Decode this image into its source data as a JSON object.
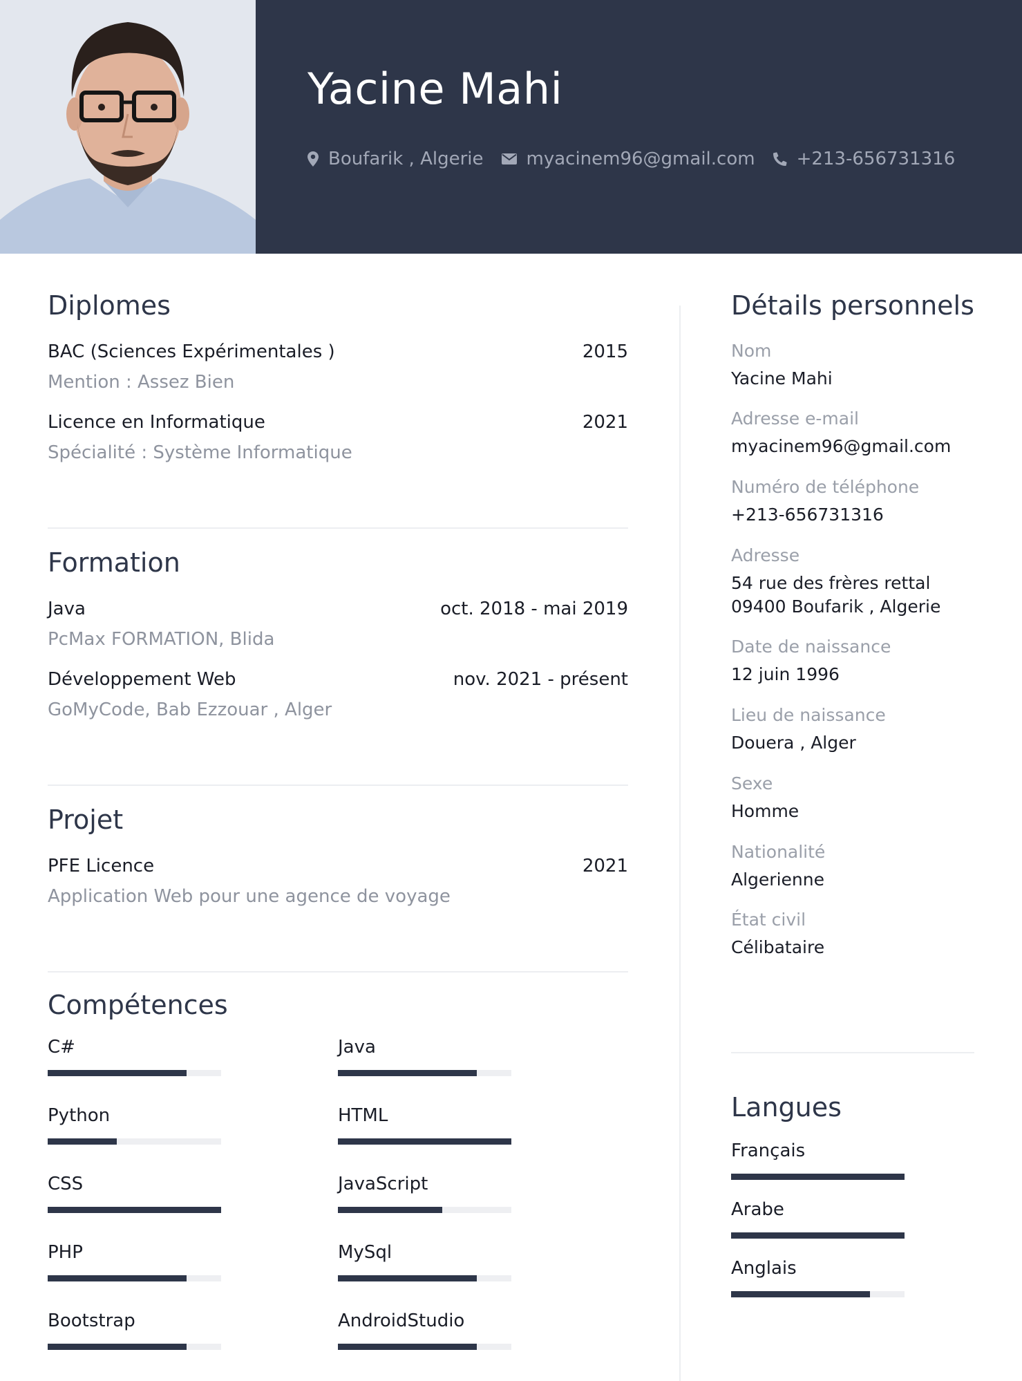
{
  "header": {
    "name": "Yacine Mahi",
    "location": "Boufarik , Algerie",
    "email": "myacinem96@gmail.com",
    "phone": "+213-656731316"
  },
  "diplomes": {
    "title": "Diplomes",
    "items": [
      {
        "title": "BAC (Sciences Expérimentales )",
        "date": "2015",
        "sub": "Mention : Assez Bien"
      },
      {
        "title": "Licence en Informatique",
        "date": "2021",
        "sub": "Spécialité : Système Informatique"
      }
    ]
  },
  "formation": {
    "title": "Formation",
    "items": [
      {
        "title": "Java",
        "date": "oct. 2018 - mai 2019",
        "sub": "PcMax FORMATION, Blida"
      },
      {
        "title": "Développement Web",
        "date": "nov. 2021 - présent",
        "sub": "GoMyCode, Bab Ezzouar , Alger"
      }
    ]
  },
  "projet": {
    "title": "Projet",
    "items": [
      {
        "title": "PFE Licence",
        "date": "2021",
        "sub": "Application Web pour une agence de voyage"
      }
    ]
  },
  "competences": {
    "title": "Compétences",
    "skills": [
      {
        "name": "C#",
        "level": 0.8
      },
      {
        "name": "Java",
        "level": 0.8
      },
      {
        "name": "Python",
        "level": 0.4
      },
      {
        "name": "HTML",
        "level": 1.0
      },
      {
        "name": "CSS",
        "level": 1.0
      },
      {
        "name": "JavaScript",
        "level": 0.6
      },
      {
        "name": "PHP",
        "level": 0.8
      },
      {
        "name": "MySql",
        "level": 0.8
      },
      {
        "name": "Bootstrap",
        "level": 0.8
      },
      {
        "name": "AndroidStudio",
        "level": 0.8
      }
    ]
  },
  "details": {
    "title": "Détails personnels",
    "items": [
      {
        "label": "Nom",
        "value": "Yacine Mahi"
      },
      {
        "label": "Adresse e-mail",
        "value": "myacinem96@gmail.com"
      },
      {
        "label": "Numéro de téléphone",
        "value": "+213-656731316"
      },
      {
        "label": "Adresse",
        "value": "54 rue des frères rettal\n09400 Boufarik , Algerie"
      },
      {
        "label": "Date de naissance",
        "value": "12 juin 1996"
      },
      {
        "label": "Lieu de naissance",
        "value": "Douera , Alger"
      },
      {
        "label": "Sexe",
        "value": "Homme"
      },
      {
        "label": "Nationalité",
        "value": "Algerienne"
      },
      {
        "label": "État civil",
        "value": "Célibataire"
      }
    ]
  },
  "langues": {
    "title": "Langues",
    "items": [
      {
        "name": "Français",
        "level": 1.0
      },
      {
        "name": "Arabe",
        "level": 1.0
      },
      {
        "name": "Anglais",
        "level": 0.8
      }
    ]
  },
  "colors": {
    "header_bg": "#2e3649",
    "bar_fill": "#2e3649",
    "bar_track": "#eeeff2",
    "muted_text": "#8e939e"
  },
  "icons": [
    "map-marker-icon",
    "envelope-icon",
    "phone-icon"
  ]
}
